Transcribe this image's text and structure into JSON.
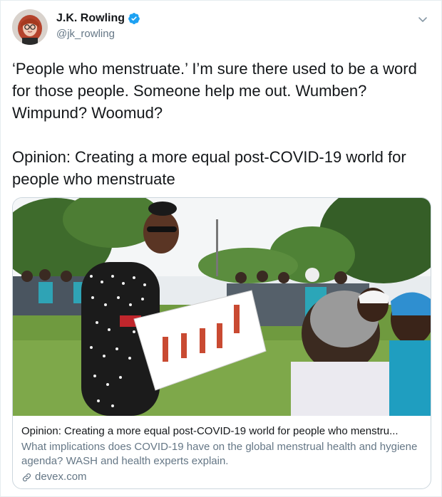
{
  "author": {
    "display_name": "J.K. Rowling",
    "handle": "@jk_rowling"
  },
  "tweet": {
    "text": "‘People who menstruate.’ I’m sure there used to be a word for those people. Someone help me out. Wumben? Wimpund? Woomud?\n\nOpinion: Creating a more equal post-COVID-19 world for people who menstruate"
  },
  "card": {
    "title": "Opinion: Creating a more equal post-COVID-19 world for people who menstru...",
    "description": "What implications does COVID-19 have on the global menstrual health and hygiene agenda? WASH and health experts explain.",
    "domain": "devex.com"
  },
  "colors": {
    "verified_blue": "#1da1f2",
    "secondary_text": "#657786",
    "border": "#ccd6dd"
  },
  "icons": {
    "verified": "verified-badge-icon",
    "menu": "chevron-down-icon",
    "link": "link-icon"
  }
}
